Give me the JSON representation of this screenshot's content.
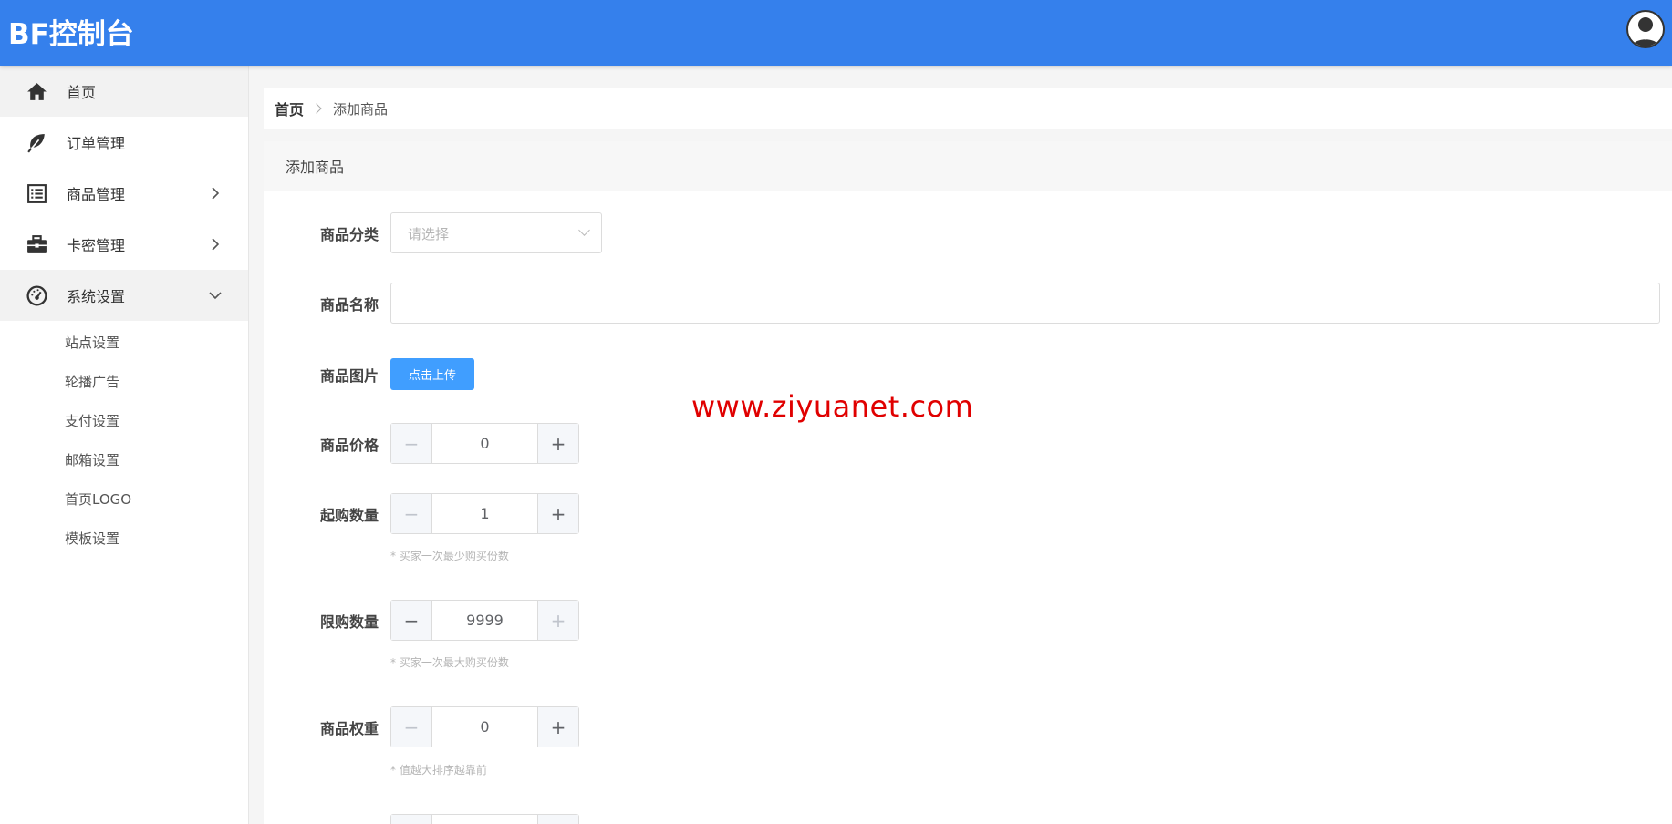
{
  "header": {
    "brand": "BF控制台",
    "accent_color": "#3580ec",
    "avatar_icon": "user-avatar-icon"
  },
  "sidebar": {
    "items": [
      {
        "label": "首页",
        "icon": "home-icon",
        "active": true
      },
      {
        "label": "订单管理",
        "icon": "leaf-icon"
      },
      {
        "label": "商品管理",
        "icon": "list-icon",
        "expandable": true
      },
      {
        "label": "卡密管理",
        "icon": "briefcase-icon",
        "expandable": true
      },
      {
        "label": "系统设置",
        "icon": "dashboard-icon",
        "expanded": true
      }
    ],
    "sub_items": [
      "站点设置",
      "轮播广告",
      "支付设置",
      "邮箱设置",
      "首页LOGO",
      "模板设置"
    ]
  },
  "breadcrumb": {
    "home": "首页",
    "current": "添加商品"
  },
  "form": {
    "title": "添加商品",
    "category": {
      "label": "商品分类",
      "placeholder": "请选择"
    },
    "name": {
      "label": "商品名称",
      "value": ""
    },
    "image": {
      "label": "商品图片",
      "button": "点击上传"
    },
    "price": {
      "label": "商品价格",
      "value": "0"
    },
    "min_qty": {
      "label": "起购数量",
      "value": "1",
      "hint": "* 买家一次最少购买份数"
    },
    "max_qty": {
      "label": "限购数量",
      "value": "9999",
      "hint": "* 买家一次最大购买份数"
    },
    "weight": {
      "label": "商品权重",
      "value": "0",
      "hint": "* 值越大排序越靠前"
    }
  },
  "watermark": "www.ziyuanet.com"
}
